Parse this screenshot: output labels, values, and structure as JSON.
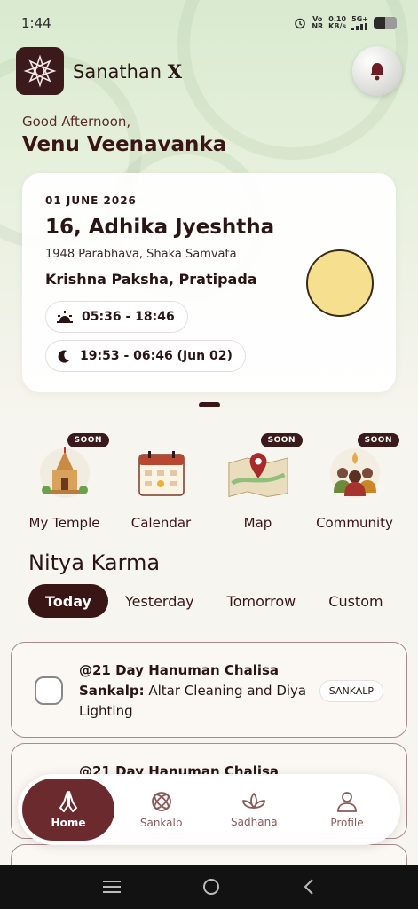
{
  "status_bar": {
    "time": "1:44",
    "vo": "Vo",
    "nr": "NR",
    "speed": "0.10",
    "speed_unit": "KB/s",
    "network": "5G+"
  },
  "header": {
    "app_name_prefix": "Sanathan",
    "app_name_suffix": "X"
  },
  "greeting": "Good Afternoon,",
  "user_name": "Venu Veenavanka",
  "panchang": {
    "date": "01 JUNE 2026",
    "title": "16, Adhika Jyeshtha",
    "samvat": "1948 Parabhava, Shaka Samvata",
    "paksha": "Krishna Paksha, Pratipada",
    "sun_times": "05:36 - 18:46",
    "moon_times": "19:53 - 06:46 (Jun 02)"
  },
  "features": [
    {
      "label": "My Temple",
      "badge": "SOON"
    },
    {
      "label": "Calendar",
      "badge": ""
    },
    {
      "label": "Map",
      "badge": "SOON"
    },
    {
      "label": "Community",
      "badge": "SOON"
    }
  ],
  "section_title": "Nitya Karma",
  "tabs": [
    "Today",
    "Yesterday",
    "Tomorrow",
    "Custom"
  ],
  "tasks": [
    {
      "title_bold": "@21 Day Hanuman Chalisa Sankalp:",
      "title_rest": " Altar Cleaning and Diya Lighting",
      "tag": "SANKALP"
    },
    {
      "title_bold": "@21 Day Hanuman Chalisa",
      "title_rest": "",
      "tag": ""
    }
  ],
  "nav": [
    {
      "label": "Home",
      "icon": "namaste-icon"
    },
    {
      "label": "Sankalp",
      "icon": "sankalp-icon"
    },
    {
      "label": "Sadhana",
      "icon": "lotus-icon"
    },
    {
      "label": "Profile",
      "icon": "profile-icon"
    }
  ],
  "colors": {
    "primary": "#3a1515",
    "nav_active": "#6b2a2e",
    "moon": "#f6e08f"
  }
}
